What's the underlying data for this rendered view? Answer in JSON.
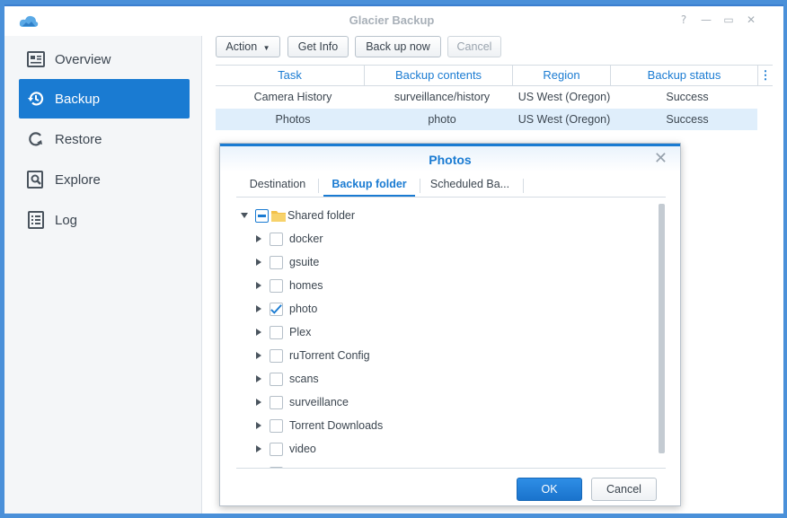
{
  "window": {
    "title": "Glacier Backup",
    "controls": {
      "help": "?",
      "minimize": "—",
      "maximize": "▭",
      "close": "✕"
    }
  },
  "sidebar": {
    "items": [
      {
        "label": "Overview",
        "icon": "overview-icon",
        "active": false
      },
      {
        "label": "Backup",
        "icon": "backup-icon",
        "active": true
      },
      {
        "label": "Restore",
        "icon": "restore-icon",
        "active": false
      },
      {
        "label": "Explore",
        "icon": "explore-icon",
        "active": false
      },
      {
        "label": "Log",
        "icon": "log-icon",
        "active": false
      }
    ]
  },
  "toolbar": {
    "action_label": "Action",
    "get_info_label": "Get Info",
    "back_up_now_label": "Back up now",
    "cancel_label": "Cancel"
  },
  "table": {
    "columns": [
      "Task",
      "Backup contents",
      "Region",
      "Backup status"
    ],
    "rows": [
      {
        "task": "Camera History",
        "contents": "surveillance/history",
        "region": "US West (Oregon)",
        "status": "Success",
        "selected": false
      },
      {
        "task": "Photos",
        "contents": "photo",
        "region": "US West (Oregon)",
        "status": "Success",
        "selected": true
      }
    ]
  },
  "dialog": {
    "title": "Photos",
    "tabs": [
      {
        "label": "Destination",
        "active": false
      },
      {
        "label": "Backup folder",
        "active": true
      },
      {
        "label": "Scheduled Ba...",
        "active": false
      }
    ],
    "root": {
      "label": "Shared folder",
      "state": "partial"
    },
    "folders": [
      {
        "label": "docker",
        "checked": false
      },
      {
        "label": "gsuite",
        "checked": false
      },
      {
        "label": "homes",
        "checked": false
      },
      {
        "label": "photo",
        "checked": true
      },
      {
        "label": "Plex",
        "checked": false
      },
      {
        "label": "ruTorrent Config",
        "checked": false
      },
      {
        "label": "scans",
        "checked": false
      },
      {
        "label": "surveillance",
        "checked": false
      },
      {
        "label": "Torrent Downloads",
        "checked": false
      },
      {
        "label": "video",
        "checked": false
      }
    ],
    "ok_label": "OK",
    "cancel_label": "Cancel"
  },
  "colors": {
    "accent": "#1a7bd2",
    "window_border": "#4a90d9",
    "selected_row": "#dfeefb",
    "sidebar_bg": "#f4f6f8"
  }
}
